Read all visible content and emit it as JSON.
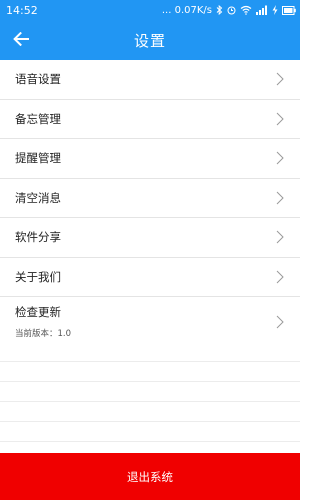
{
  "status_bar": {
    "time": "14:52",
    "speed": "... 0.07K/s",
    "icons": [
      "bluetooth-icon",
      "alarm-icon",
      "wifi-icon",
      "signal-icon",
      "charging-icon",
      "battery-icon"
    ],
    "bg_color": "#2196f3"
  },
  "app_bar": {
    "title": "设置",
    "back_icon": "back-arrow-icon",
    "bg_color": "#2196f3"
  },
  "settings": {
    "items": [
      {
        "label": "语音设置"
      },
      {
        "label": "备忘管理"
      },
      {
        "label": "提醒管理"
      },
      {
        "label": "清空消息"
      },
      {
        "label": "软件分享"
      },
      {
        "label": "关于我们"
      },
      {
        "label": "检查更新",
        "sub": "当前版本：1.0"
      }
    ]
  },
  "footer": {
    "logout_label": "退出系统",
    "bg_color": "#f00000"
  }
}
